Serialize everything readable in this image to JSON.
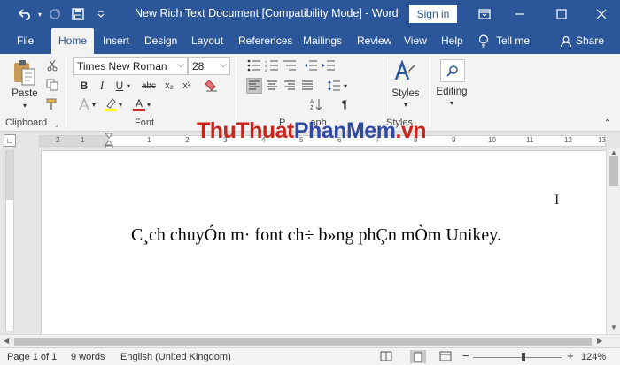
{
  "titlebar": {
    "title": "New Rich Text Document [Compatibility Mode]  -  Word",
    "signin": "Sign in",
    "undo_icon": "undo-icon",
    "redo_icon": "redo-icon",
    "save_icon": "save-icon",
    "customize_icon": "chevron-down-icon",
    "ribbon_display_icon": "ribbon-display-icon",
    "minimize_icon": "minimize-icon",
    "maximize_icon": "maximize-icon",
    "close_icon": "close-icon"
  },
  "tabs": [
    "File",
    "Home",
    "Insert",
    "Design",
    "Layout",
    "References",
    "Mailings",
    "Review",
    "View",
    "Help",
    "Tell me",
    "Share"
  ],
  "ribbon": {
    "paste_label": "Paste",
    "clipboard_label": "Clipboard",
    "font_label": "Font",
    "paragraph_label_partial": "P",
    "paragraph_label_tail": "aph",
    "styles_group_label": "Styles",
    "font_name": "Times New Roman",
    "font_size": "28",
    "bold": "B",
    "italic": "I",
    "underline": "U",
    "strike": "abc",
    "subscript": "x₂",
    "superscript": "x²",
    "font_color_letter": "A",
    "styles_button": "Styles",
    "editing_button": "Editing"
  },
  "document": {
    "text": "C¸ch chuyÓn m· font ch÷ b»ng phÇn mÒm Unikey."
  },
  "watermark": {
    "part1": "ThuThuat",
    "part2": "PhanMem",
    "part3": ".vn"
  },
  "ruler": {
    "numbers": [
      "2",
      "1",
      "1",
      "2",
      "3",
      "4",
      "5",
      "6",
      "7",
      "8",
      "9",
      "10",
      "11",
      "12",
      "13"
    ]
  },
  "status": {
    "page": "Page 1 of 1",
    "words": "9 words",
    "language": "English (United Kingdom)",
    "zoom": "124%",
    "zoom_minus": "−",
    "zoom_plus": "+"
  },
  "colors": {
    "title_bar": "#2b579a",
    "ribbon": "#f3f3f3",
    "watermark_red": "#c8261c",
    "watermark_blue": "#2f4aa0"
  }
}
